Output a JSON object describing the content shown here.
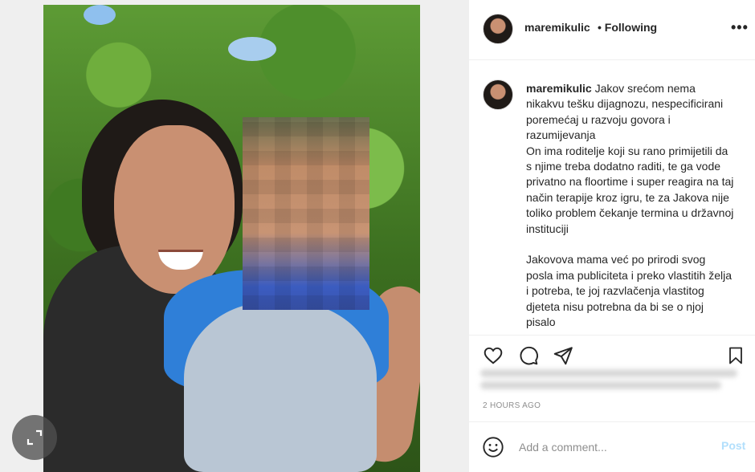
{
  "post": {
    "username": "maremikulic",
    "follow_status": "• Following",
    "more_icon": "more-horizontal-icon",
    "caption": "Jakov srećom nema nikakvu tešku dijagnozu, nespecificirani poremećaj u razvoju govora i razumijevanja\nOn ima roditelje koji su rano primijetili da s njime treba dodatno raditi, te ga vode privatno na floortime i super reagira na taj način terapije kroz igru, te za Jakova nije toliko problem čekanje termina u državnoj instituciji\n\nJakovova mama već po prirodi svog posla ima publiciteta i preko vlastitih želja i potreba, te joj razvlačenja vlastitog djeteta nisu potrebna da bi se o njoj pisalo",
    "timestamp": "2 HOURS AGO"
  },
  "actions": {
    "like_icon": "heart-icon",
    "comment_icon": "comment-icon",
    "share_icon": "share-icon",
    "save_icon": "bookmark-icon"
  },
  "add_comment": {
    "placeholder": "Add a comment...",
    "post_label": "Post",
    "emoji_icon": "emoji-icon"
  },
  "media": {
    "expand_icon": "expand-icon"
  },
  "colors": {
    "post_button": "#b2dffc",
    "muted_text": "#8e8e8e",
    "border": "#efefef"
  }
}
